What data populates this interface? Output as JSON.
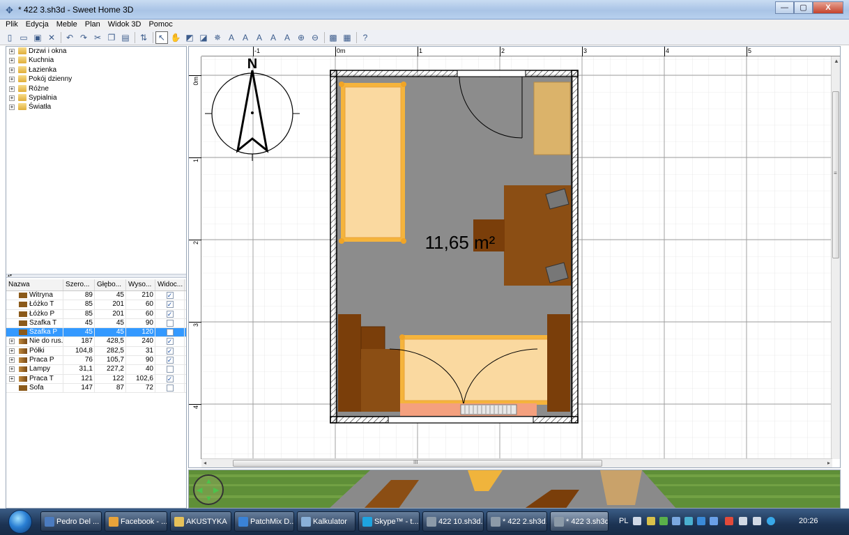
{
  "window": {
    "title": "* 422 3.sh3d - Sweet Home 3D",
    "minimize": "—",
    "maximize": "▢",
    "close": "X"
  },
  "menu": [
    "Plik",
    "Edycja",
    "Meble",
    "Plan",
    "Widok 3D",
    "Pomoc"
  ],
  "catalog": [
    "Drzwi i okna",
    "Kuchnia",
    "Łazienka",
    "Pokój dzienny",
    "Różne",
    "Sypialnia",
    "Światła"
  ],
  "furniture_table": {
    "headers": [
      "Nazwa",
      "Szero...",
      "Głębo...",
      "Wyso...",
      "Widoc..."
    ],
    "rows": [
      {
        "name": "Witryna",
        "w": "89",
        "d": "45",
        "h": "210",
        "visible": "✓",
        "group": false
      },
      {
        "name": "Łóżko T",
        "w": "85",
        "d": "201",
        "h": "60",
        "visible": "✓",
        "group": false
      },
      {
        "name": "Łóżko P",
        "w": "85",
        "d": "201",
        "h": "60",
        "visible": "✓",
        "group": false
      },
      {
        "name": "Szafka T",
        "w": "45",
        "d": "45",
        "h": "90",
        "visible": "",
        "group": false
      },
      {
        "name": "Szafka P",
        "w": "45",
        "d": "45",
        "h": "120",
        "visible": "",
        "group": false,
        "selected": true
      },
      {
        "name": "Nie do rus...",
        "w": "187",
        "d": "428,5",
        "h": "240",
        "visible": "✓",
        "group": true
      },
      {
        "name": "Półki",
        "w": "104,8",
        "d": "282,5",
        "h": "31",
        "visible": "✓",
        "group": true
      },
      {
        "name": "Praca P",
        "w": "76",
        "d": "105,7",
        "h": "90",
        "visible": "✓",
        "group": true
      },
      {
        "name": "Lampy",
        "w": "31,1",
        "d": "227,2",
        "h": "40",
        "visible": "",
        "group": true
      },
      {
        "name": "Praca T",
        "w": "121",
        "d": "122",
        "h": "102,6",
        "visible": "✓",
        "group": true
      },
      {
        "name": "Sofa",
        "w": "147",
        "d": "87",
        "h": "72",
        "visible": "",
        "group": false
      }
    ]
  },
  "plan": {
    "ruler_top": [
      "-1",
      "0m",
      "1",
      "2",
      "3",
      "4",
      "5"
    ],
    "ruler_left": [
      "0m",
      "1",
      "2",
      "3",
      "4"
    ],
    "room_area": "11,65 m²",
    "compass_label": "N",
    "h_scroll_mark": "III",
    "v_scroll_mark": "≡"
  },
  "taskbar": {
    "items": [
      {
        "label": "Pedro Del ...",
        "color": "#4b7bbf"
      },
      {
        "label": "Facebook - ...",
        "color": "#e8a33a"
      },
      {
        "label": "AKUSTYKA",
        "color": "#e6c15a"
      },
      {
        "label": "PatchMix D...",
        "color": "#3a82d6"
      },
      {
        "label": "Kalkulator",
        "color": "#8ab0d8"
      },
      {
        "label": "Skype™ - t...",
        "color": "#1ea4e0"
      },
      {
        "label": "422 10.sh3d...",
        "color": "#8c9aa8"
      },
      {
        "label": "* 422 2.sh3d...",
        "color": "#8c9aa8"
      },
      {
        "label": "* 422 3.sh3d...",
        "color": "#8c9aa8",
        "active": true
      }
    ],
    "lang": "PL",
    "clock": "20:26"
  }
}
